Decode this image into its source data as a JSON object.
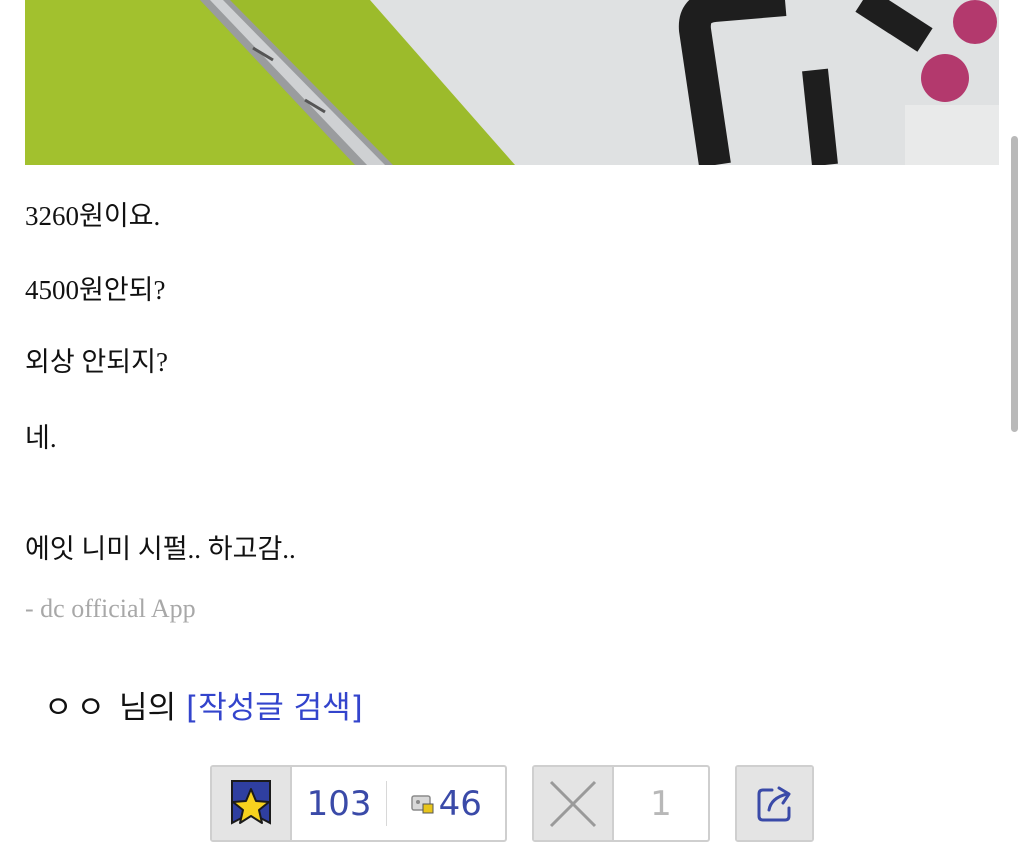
{
  "post": {
    "lines": [
      "3260원이요.",
      "4500원안되?",
      "외상 안되지?",
      "네.",
      "에잇 니미 시펄.. 하고감.."
    ],
    "signature": "- dc official App"
  },
  "author": {
    "nickname": "ㅇㅇ",
    "suffix": "님의",
    "search_link": "[작성글 검색]"
  },
  "actions": {
    "upvote_count": "103",
    "fixed_upvote_count": "46",
    "downvote_count": "1"
  },
  "colors": {
    "link": "#3344cc",
    "count": "#3a4aa8",
    "muted": "#a8a8a8"
  }
}
